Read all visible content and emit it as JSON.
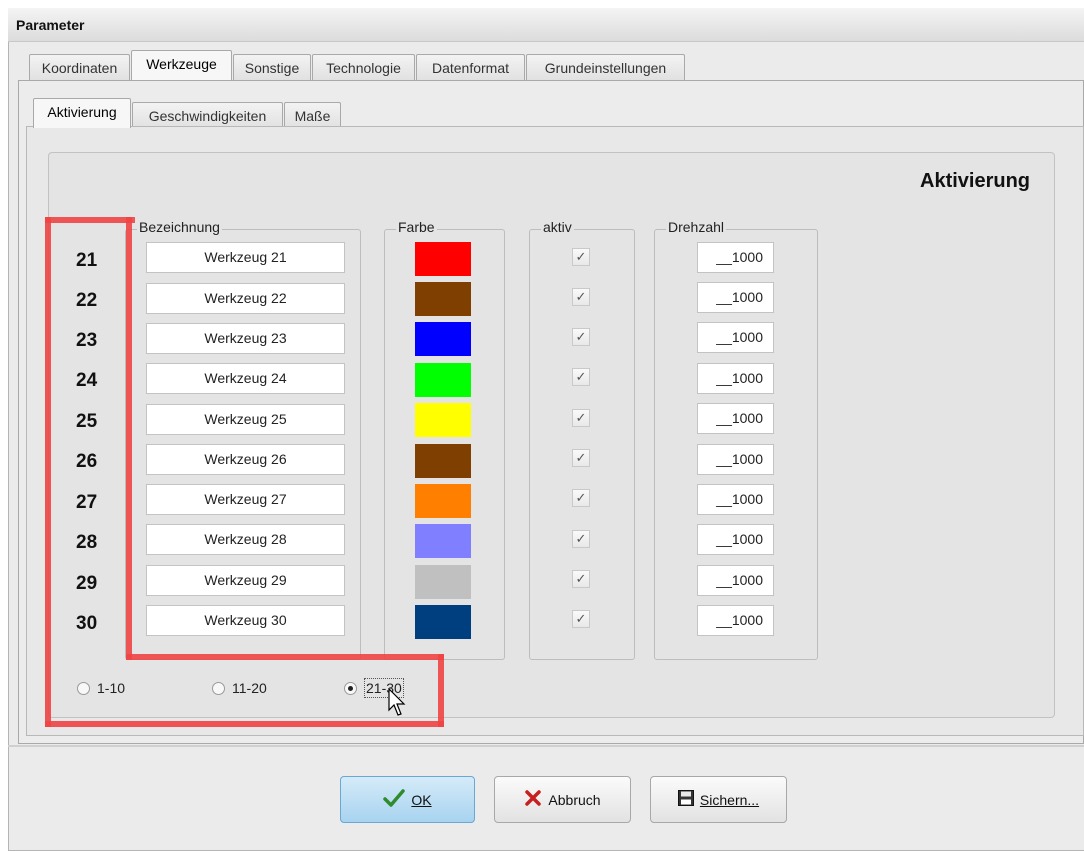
{
  "window": {
    "title": "Parameter"
  },
  "main_tabs": [
    {
      "label": "Koordinaten"
    },
    {
      "label": "Werkzeuge"
    },
    {
      "label": "Sonstige"
    },
    {
      "label": "Technologie"
    },
    {
      "label": "Datenformat"
    },
    {
      "label": "Grundeinstellungen"
    }
  ],
  "active_main_tab": "Werkzeuge",
  "sub_tabs": [
    {
      "label": "Aktivierung"
    },
    {
      "label": "Geschwindigkeiten"
    },
    {
      "label": "Maße"
    }
  ],
  "active_sub_tab": "Aktivierung",
  "section": {
    "heading": "Aktivierung"
  },
  "columns": {
    "name": "Bezeichnung",
    "color": "Farbe",
    "active": "aktiv",
    "rpm": "Drehzahl"
  },
  "tools": [
    {
      "number": "21",
      "name": "Werkzeug 21",
      "color": "#ff0000",
      "active": true,
      "rpm": "__1000"
    },
    {
      "number": "22",
      "name": "Werkzeug 22",
      "color": "#7f3f00",
      "active": true,
      "rpm": "__1000"
    },
    {
      "number": "23",
      "name": "Werkzeug 23",
      "color": "#0000ff",
      "active": true,
      "rpm": "__1000"
    },
    {
      "number": "24",
      "name": "Werkzeug 24",
      "color": "#00ff00",
      "active": true,
      "rpm": "__1000"
    },
    {
      "number": "25",
      "name": "Werkzeug 25",
      "color": "#ffff00",
      "active": true,
      "rpm": "__1000"
    },
    {
      "number": "26",
      "name": "Werkzeug 26",
      "color": "#7f3f00",
      "active": true,
      "rpm": "__1000"
    },
    {
      "number": "27",
      "name": "Werkzeug 27",
      "color": "#ff7f00",
      "active": true,
      "rpm": "__1000"
    },
    {
      "number": "28",
      "name": "Werkzeug 28",
      "color": "#7f7fff",
      "active": true,
      "rpm": "__1000"
    },
    {
      "number": "29",
      "name": "Werkzeug 29",
      "color": "#c0c0c0",
      "active": true,
      "rpm": "__1000"
    },
    {
      "number": "30",
      "name": "Werkzeug 30",
      "color": "#003f7f",
      "active": true,
      "rpm": "__1000"
    }
  ],
  "range_options": [
    {
      "label": "1-10",
      "selected": false
    },
    {
      "label": "11-20",
      "selected": false
    },
    {
      "label": "21-30",
      "selected": true
    }
  ],
  "check_glyph": "✓",
  "buttons": {
    "ok": "OK",
    "cancel": "Abbruch",
    "save": "Sichern..."
  },
  "icons": {
    "ok": "checkmark-icon",
    "cancel": "x-icon",
    "save": "floppy-disk-icon"
  },
  "colors": {
    "highlight": "#ee4444",
    "ok_button": "#a8d3f0"
  }
}
